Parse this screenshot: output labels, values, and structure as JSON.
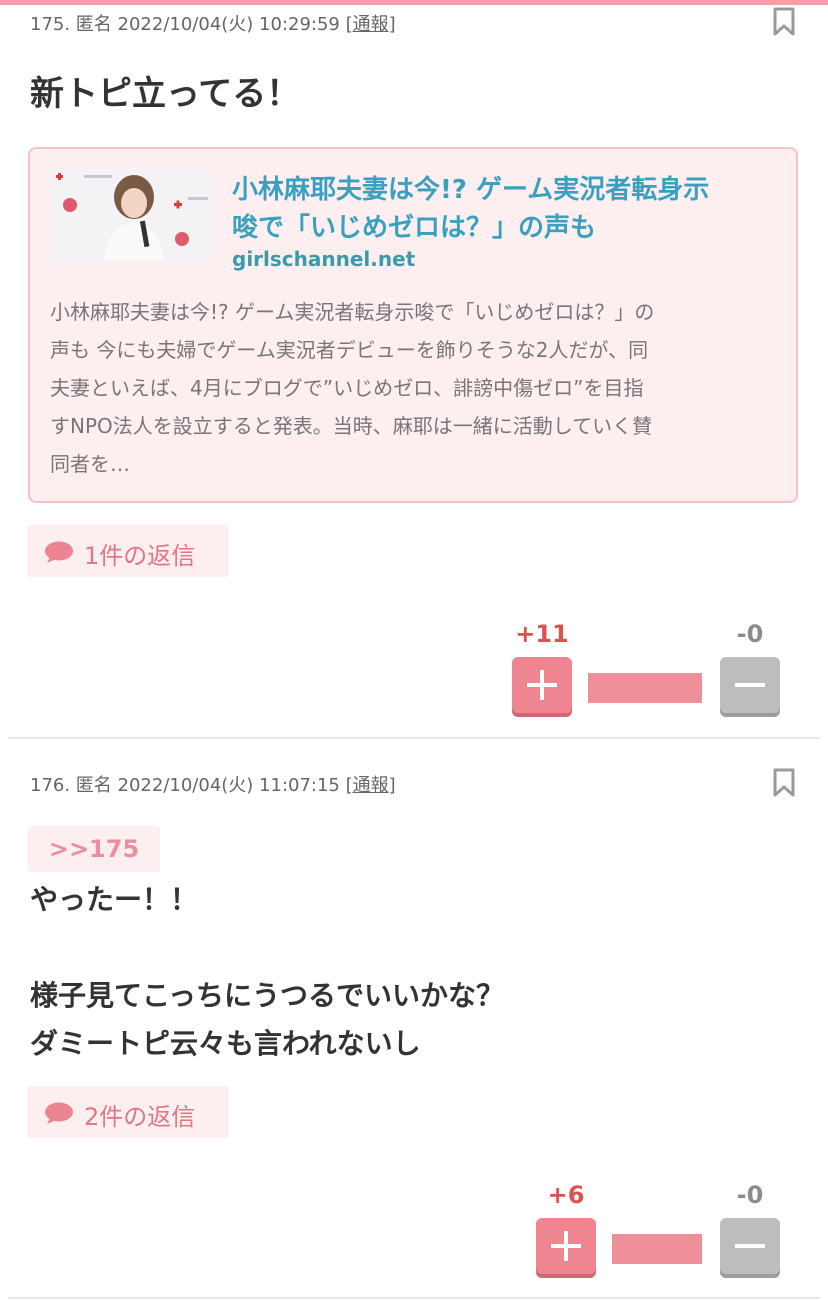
{
  "comments": [
    {
      "meta": "175. 匿名 2022/10/04(火) 10:29:59",
      "report": "[通報]",
      "body": "新トピ立ってる！",
      "link_card": {
        "title_line1": "小林麻耶夫妻は今!? ゲーム実況者転身示",
        "title_line2": "唆で「いじめゼロは？」の声も",
        "site": "girlschannel.net",
        "desc_lines": [
          "小林麻耶夫妻は今!? ゲーム実況者転身示唆で「いじめゼロは？」の",
          "声も 今にも夫婦でゲーム実況者デビューを飾りそうな2人だが、同",
          "夫妻といえば、4月にブログで”いじめゼロ、誹謗中傷ゼロ”を目指",
          "すNPO法人を設立すると発表。当時、麻耶は一緒に活動していく賛",
          "同者を…"
        ]
      },
      "reply_label": "1件の返信",
      "plus": "+11",
      "minus": "-0",
      "plus_ratio": 1.0
    },
    {
      "meta": "176. 匿名 2022/10/04(火) 11:07:15",
      "report": "[通報]",
      "anchor": ">>175",
      "body_lines": [
        "やったー！！",
        "",
        "様子見てこっちにうつるでいいかな？",
        "ダミートピ云々も言われないし"
      ],
      "reply_label": "2件の返信",
      "plus": "+6",
      "minus": "-0",
      "plus_ratio": 1.0
    }
  ],
  "colors": {
    "accent_pink": "#ef8591",
    "link_blue": "#3aa0bf",
    "plus_red": "#d9534f",
    "minus_gray": "#bdbdbd"
  },
  "icons": [
    "bookmark-icon",
    "speech-bubble-icon",
    "plus-icon",
    "minus-icon"
  ]
}
